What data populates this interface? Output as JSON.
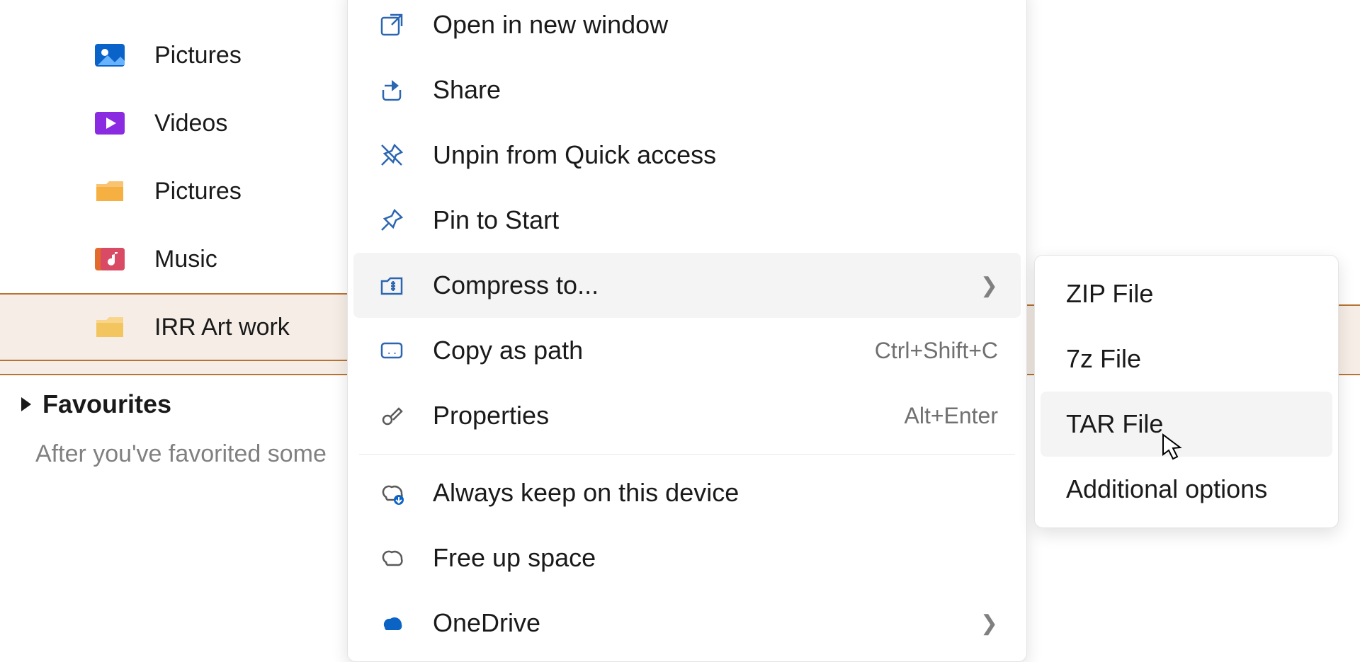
{
  "sidebar": {
    "items": [
      {
        "label": "Pictures",
        "icon": "pictures-app"
      },
      {
        "label": "Videos",
        "icon": "videos"
      },
      {
        "label": "Pictures",
        "icon": "folder"
      },
      {
        "label": "Music",
        "icon": "music"
      },
      {
        "label": "IRR Art work",
        "icon": "folder",
        "selected": true
      }
    ],
    "favourites": {
      "title": "Favourites",
      "empty_text": "After you've favorited some"
    }
  },
  "context_menu": {
    "items": [
      {
        "icon": "open-new-window",
        "label": "Open in new window"
      },
      {
        "icon": "share",
        "label": "Share"
      },
      {
        "icon": "unpin",
        "label": "Unpin from Quick access"
      },
      {
        "icon": "pin",
        "label": "Pin to Start"
      },
      {
        "icon": "compress",
        "label": "Compress to...",
        "submenu": true,
        "hover": true
      },
      {
        "icon": "copy-path",
        "label": "Copy as path",
        "shortcut": "Ctrl+Shift+C"
      },
      {
        "icon": "properties",
        "label": "Properties",
        "shortcut": "Alt+Enter"
      },
      {
        "divider": true
      },
      {
        "icon": "cloud-keep",
        "label": "Always keep on this device"
      },
      {
        "icon": "cloud-free",
        "label": "Free up space"
      },
      {
        "icon": "onedrive",
        "label": "OneDrive",
        "submenu": true
      }
    ]
  },
  "submenu": {
    "items": [
      {
        "label": "ZIP File"
      },
      {
        "label": "7z File"
      },
      {
        "label": "TAR File",
        "hover": true
      },
      {
        "label": "Additional options"
      }
    ]
  }
}
